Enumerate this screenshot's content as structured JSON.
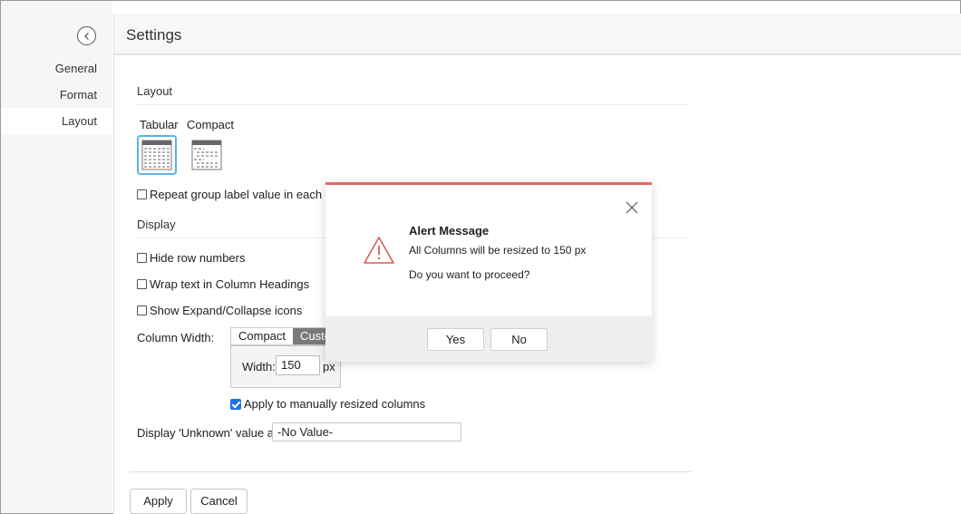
{
  "sidebar": {
    "items": [
      {
        "label": "General"
      },
      {
        "label": "Format"
      },
      {
        "label": "Layout"
      }
    ]
  },
  "header": {
    "title": "Settings"
  },
  "layout_section": {
    "title": "Layout",
    "options": [
      {
        "label": "Tabular",
        "selected": true
      },
      {
        "label": "Compact",
        "selected": false
      }
    ],
    "repeat_group_label": "Repeat group label value in each row"
  },
  "display_section": {
    "title": "Display",
    "hide_row_numbers": "Hide row numbers",
    "wrap_text": "Wrap text in Column Headings",
    "show_expand": "Show Expand/Collapse icons",
    "column_width_label": "Column Width:",
    "column_width_options": [
      "Compact",
      "Custo"
    ],
    "width_label": "Width:",
    "width_value": "150",
    "width_unit": "px",
    "apply_manual": "Apply to manually resized columns",
    "unknown_label": "Display 'Unknown' value as:",
    "unknown_value": "-No Value-"
  },
  "footer": {
    "apply": "Apply",
    "cancel": "Cancel"
  },
  "modal": {
    "title": "Alert Message",
    "message": "All Columns will be resized to 150 px",
    "question": "Do you want to proceed?",
    "yes": "Yes",
    "no": "No"
  },
  "colors": {
    "accent_border": "#e06969",
    "selected_thumb": "#58b6e0",
    "checkbox_checked": "#1a73e8"
  }
}
